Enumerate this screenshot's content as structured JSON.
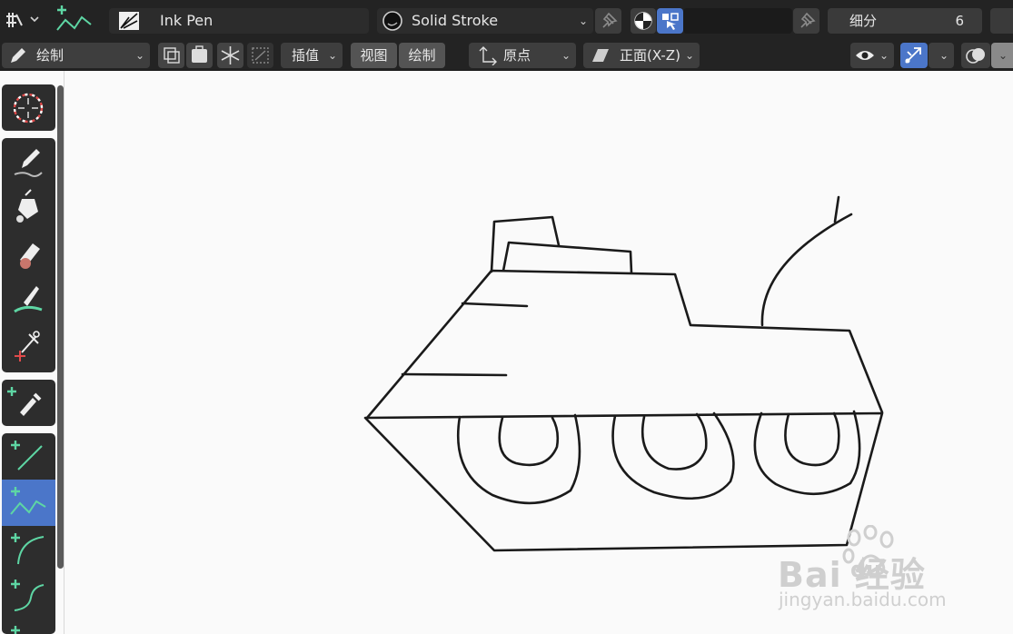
{
  "header": {
    "brush_name": "Ink Pen",
    "material_name": "Solid Stroke",
    "subdivide_label": "细分",
    "subdivide_value": "6"
  },
  "toolbar2": {
    "mode_label": "绘制",
    "interpolate_label": "插值",
    "view_label": "视图",
    "draw_label": "绘制",
    "origin_label": "原点",
    "plane_label": "正面(X-Z)"
  },
  "tools": [
    "cursor-tool",
    "draw-tool",
    "fill-tool",
    "erase-tool",
    "tint-tool",
    "cutter-tool",
    "eyedropper-tool",
    "line-tool",
    "polyline-tool",
    "arc-tool",
    "curve-tool",
    "box-tool"
  ],
  "active_tool": "polyline-tool",
  "colors": {
    "header_bg": "#232323",
    "canvas_bg": "#fafafa",
    "accent": "#4b76c9",
    "stroke": "#1a1a1a",
    "tool_green": "#5ed6a4"
  },
  "watermark": {
    "text": "Bai  经验",
    "du": "du",
    "url": "jingyan.baidu.com"
  }
}
